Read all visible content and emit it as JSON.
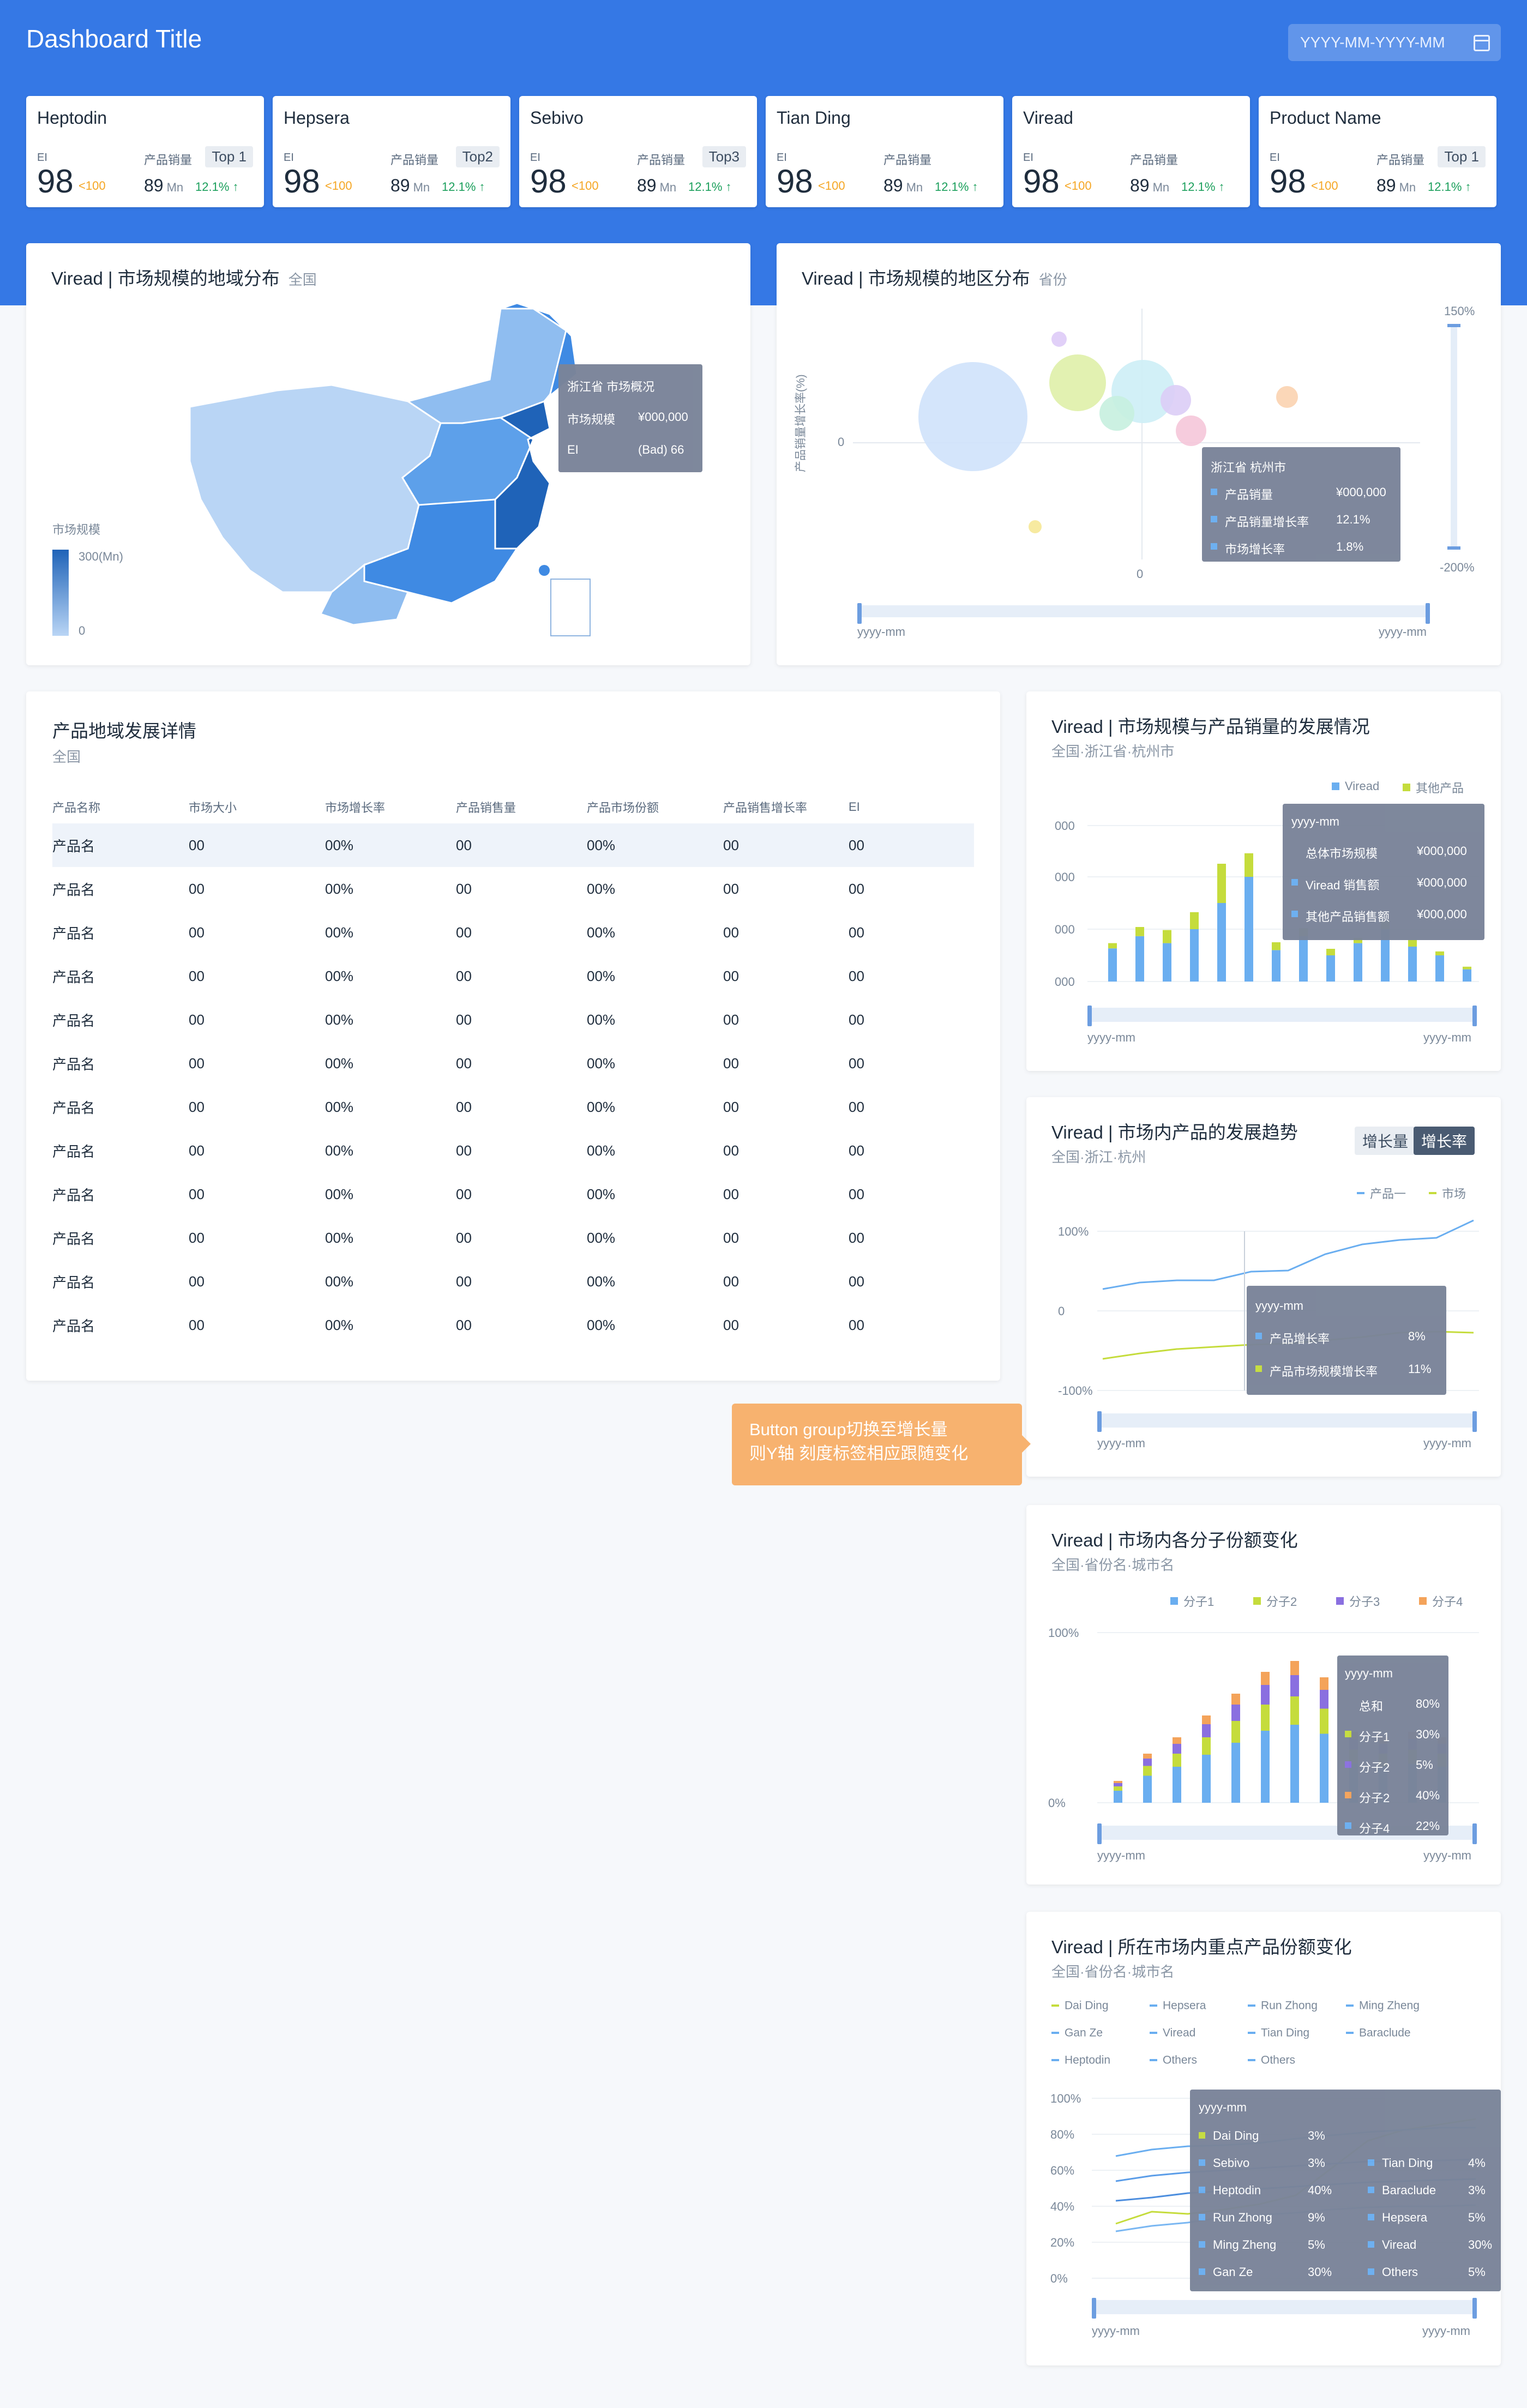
{
  "header": {
    "title": "Dashboard Title",
    "date_range": "YYYY-MM-YYYY-MM"
  },
  "kpis": [
    {
      "name": "Heptodin",
      "ei_label": "EI",
      "ei_value": "98",
      "ei_note": "<100",
      "sales_label": "产品销量",
      "rank": "Top 1",
      "sales_value": "89",
      "unit": "Mn",
      "growth": "12.1% ↑"
    },
    {
      "name": "Hepsera",
      "ei_label": "EI",
      "ei_value": "98",
      "ei_note": "<100",
      "sales_label": "产品销量",
      "rank": "Top2",
      "sales_value": "89",
      "unit": "Mn",
      "growth": "12.1% ↑"
    },
    {
      "name": "Sebivo",
      "ei_label": "EI",
      "ei_value": "98",
      "ei_note": "<100",
      "sales_label": "产品销量",
      "rank": "Top3",
      "sales_value": "89",
      "unit": "Mn",
      "growth": "12.1% ↑"
    },
    {
      "name": "Tian Ding",
      "ei_label": "EI",
      "ei_value": "98",
      "ei_note": "<100",
      "sales_label": "产品销量",
      "rank": "",
      "sales_value": "89",
      "unit": "Mn",
      "growth": "12.1% ↑"
    },
    {
      "name": "Viread",
      "ei_label": "EI",
      "ei_value": "98",
      "ei_note": "<100",
      "sales_label": "产品销量",
      "rank": "",
      "sales_value": "89",
      "unit": "Mn",
      "growth": "12.1% ↑"
    },
    {
      "name": "Product Name",
      "ei_label": "EI",
      "ei_value": "98",
      "ei_note": "<100",
      "sales_label": "产品销量",
      "rank": "Top 1",
      "sales_value": "89",
      "unit": "Mn",
      "growth": "12.1% ↑"
    }
  ],
  "map_card": {
    "title": "Viread | 市场规模的地域分布",
    "subtitle": "全国",
    "legend_title": "市场规模",
    "legend_max": "300(Mn)",
    "legend_min": "0",
    "tooltip": {
      "title": "浙江省 市场概况",
      "row1_label": "市场规模",
      "row1_value": "¥000,000",
      "row2_label": "EI",
      "row2_value": "(Bad) 66"
    }
  },
  "bubble_card": {
    "title": "Viread | 市场规模的地区分布",
    "subtitle": "省份",
    "ylabel": "产品销量增长率(%)",
    "y_zero": "0",
    "x_zero": "0",
    "slider_top": "150%",
    "slider_bottom": "-200%",
    "x_start": "yyyy-mm",
    "x_end": "yyyy-mm",
    "tooltip": {
      "title": "浙江省 杭州市",
      "rows": [
        {
          "label": "产品销量",
          "value": "¥000,000"
        },
        {
          "label": "产品销量增长率",
          "value": "12.1%"
        },
        {
          "label": "市场增长率",
          "value": "1.8%"
        }
      ]
    }
  },
  "table_card": {
    "title": "产品地域发展详情",
    "subtitle": "全国",
    "columns": [
      "产品名称",
      "市场大小",
      "市场增长率",
      "产品销售量",
      "产品市场份额",
      "产品销售增长率",
      "EI"
    ],
    "rows": [
      [
        "产品名",
        "00",
        "00%",
        "00",
        "00%",
        "00",
        "00"
      ],
      [
        "产品名",
        "00",
        "00%",
        "00",
        "00%",
        "00",
        "00"
      ],
      [
        "产品名",
        "00",
        "00%",
        "00",
        "00%",
        "00",
        "00"
      ],
      [
        "产品名",
        "00",
        "00%",
        "00",
        "00%",
        "00",
        "00"
      ],
      [
        "产品名",
        "00",
        "00%",
        "00",
        "00%",
        "00",
        "00"
      ],
      [
        "产品名",
        "00",
        "00%",
        "00",
        "00%",
        "00",
        "00"
      ],
      [
        "产品名",
        "00",
        "00%",
        "00",
        "00%",
        "00",
        "00"
      ],
      [
        "产品名",
        "00",
        "00%",
        "00",
        "00%",
        "00",
        "00"
      ],
      [
        "产品名",
        "00",
        "00%",
        "00",
        "00%",
        "00",
        "00"
      ],
      [
        "产品名",
        "00",
        "00%",
        "00",
        "00%",
        "00",
        "00"
      ],
      [
        "产品名",
        "00",
        "00%",
        "00",
        "00%",
        "00",
        "00"
      ],
      [
        "产品名",
        "00",
        "00%",
        "00",
        "00%",
        "00",
        "00"
      ]
    ]
  },
  "bar_card": {
    "title": "Viread | 市场规模与产品销量的发展情况",
    "subtitle": "全国·浙江省·杭州市",
    "legend": [
      "Viread",
      "其他产品"
    ],
    "yticks": [
      "000",
      "000",
      "000",
      "000"
    ],
    "x_start": "yyyy-mm",
    "x_end": "yyyy-mm",
    "tooltip": {
      "title": "yyyy-mm",
      "rows": [
        {
          "label": "总体市场规模",
          "value": "¥000,000"
        },
        {
          "label": "Viread 销售额",
          "value": "¥000,000"
        },
        {
          "label": "其他产品销售额",
          "value": "¥000,000"
        }
      ]
    }
  },
  "line_card": {
    "title": "Viread | 市场内产品的发展趋势",
    "subtitle": "全国·浙江·杭州",
    "btn1": "增长量",
    "btn2": "增长率",
    "legend": [
      "产品一",
      "市场"
    ],
    "yticks": [
      "100%",
      "0",
      "-100%"
    ],
    "x_start": "yyyy-mm",
    "x_end": "yyyy-mm",
    "tooltip": {
      "title": "yyyy-mm",
      "rows": [
        {
          "label": "产品增长率",
          "value": "8%"
        },
        {
          "label": "产品市场规模增长率",
          "value": "11%"
        }
      ]
    }
  },
  "note": {
    "text": "Button group切换至增长量\n则Y轴 刻度标签相应跟随变化"
  },
  "stack_card": {
    "title": "Viread | 市场内各分子份额变化",
    "subtitle": "全国·省份名·城市名",
    "legend": [
      "分子1",
      "分子2",
      "分子3",
      "分子4"
    ],
    "yticks": [
      "100%",
      "0%"
    ],
    "x_start": "yyyy-mm",
    "x_end": "yyyy-mm",
    "tooltip": {
      "title": "yyyy-mm",
      "rows": [
        {
          "label": "总和",
          "value": "80%"
        },
        {
          "label": "分子1",
          "value": "30%"
        },
        {
          "label": "分子2",
          "value": "5%"
        },
        {
          "label": "分子2",
          "value": "40%"
        },
        {
          "label": "分子4",
          "value": "22%"
        }
      ]
    }
  },
  "multi_card": {
    "title": "Viread | 所在市场内重点产品份额变化",
    "subtitle": "全国·省份名·城市名",
    "legend": [
      "Dai Ding",
      "Hepsera",
      "Run Zhong",
      "Ming Zheng",
      "Gan Ze",
      "Viread",
      "Tian Ding",
      "Baraclude",
      "Heptodin",
      "Others",
      "Others"
    ],
    "yticks": [
      "100%",
      "80%",
      "60%",
      "40%",
      "20%",
      "0%"
    ],
    "x_start": "yyyy-mm",
    "x_end": "yyyy-mm",
    "tooltip": {
      "title": "yyyy-mm",
      "left": [
        {
          "label": "Dai Ding",
          "value": "3%"
        },
        {
          "label": "Sebivo",
          "value": "3%"
        },
        {
          "label": "Heptodin",
          "value": "40%"
        },
        {
          "label": "Run Zhong",
          "value": "9%"
        },
        {
          "label": "Ming Zheng",
          "value": "5%"
        },
        {
          "label": "Gan Ze",
          "value": "30%"
        }
      ],
      "right": [
        {
          "label": "Tian Ding",
          "value": "4%"
        },
        {
          "label": "Baraclude",
          "value": "3%"
        },
        {
          "label": "Hepsera",
          "value": "5%"
        },
        {
          "label": "Viread",
          "value": "30%"
        },
        {
          "label": "Others",
          "value": "5%"
        }
      ]
    }
  },
  "colors": {
    "primary": "#3578e5",
    "blue": "#6aaef0",
    "lime": "#c5dc3c",
    "purple": "#8a6fe0",
    "orange": "#f4a35a",
    "tooltip": "#7a8499"
  }
}
